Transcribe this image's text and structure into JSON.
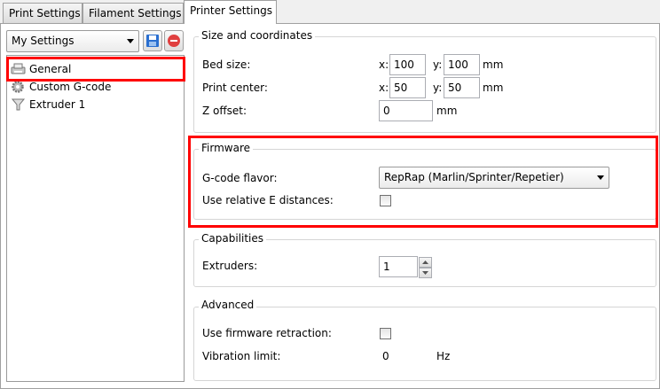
{
  "tabs": [
    {
      "label": "Print Settings"
    },
    {
      "label": "Filament Settings"
    },
    {
      "label": "Printer Settings"
    }
  ],
  "preset": {
    "selected": "My Settings"
  },
  "tree": {
    "items": [
      {
        "label": "General",
        "icon": "printer-icon"
      },
      {
        "label": "Custom G-code",
        "icon": "gear-icon"
      },
      {
        "label": "Extruder 1",
        "icon": "funnel-icon"
      }
    ]
  },
  "size": {
    "title": "Size and coordinates",
    "bed_label": "Bed size:",
    "bed_x": "100",
    "bed_y": "100",
    "center_label": "Print center:",
    "center_x": "50",
    "center_y": "50",
    "z_label": "Z offset:",
    "z_value": "0",
    "x_prefix": "x:",
    "y_prefix": "y:",
    "unit_mm": "mm"
  },
  "firmware": {
    "title": "Firmware",
    "flavor_label": "G-code flavor:",
    "flavor_value": "RepRap (Marlin/Sprinter/Repetier)",
    "relative_label": "Use relative E distances:"
  },
  "capabilities": {
    "title": "Capabilities",
    "extruders_label": "Extruders:",
    "extruders_value": "1"
  },
  "advanced": {
    "title": "Advanced",
    "retraction_label": "Use firmware retraction:",
    "vibration_label": "Vibration limit:",
    "vibration_value": "0",
    "vibration_unit": "Hz"
  },
  "colors": {
    "highlight": "#ff0000",
    "save_icon": "#2a6fd0",
    "delete_icon": "#e04040"
  }
}
